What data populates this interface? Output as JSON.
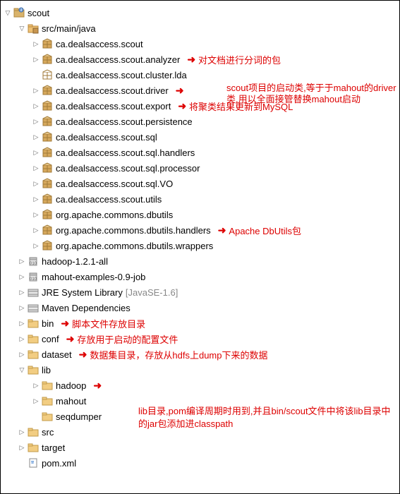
{
  "tree": {
    "root": {
      "label": "scout"
    },
    "srcMainJava": {
      "label": "src/main/java"
    },
    "packages": [
      {
        "label": "ca.dealsaccess.scout",
        "toggle": "closed",
        "icon": "package"
      },
      {
        "label": "ca.dealsaccess.scout.analyzer",
        "toggle": "closed",
        "icon": "package",
        "note": "对文档进行分词的包"
      },
      {
        "label": "ca.dealsaccess.scout.cluster.lda",
        "toggle": "none",
        "icon": "package-empty"
      },
      {
        "label": "ca.dealsaccess.scout.driver",
        "toggle": "closed",
        "icon": "package",
        "arrow": true
      },
      {
        "label": "ca.dealsaccess.scout.export",
        "toggle": "closed",
        "icon": "package",
        "note": "将聚类结果更新到MySQL"
      },
      {
        "label": "ca.dealsaccess.scout.persistence",
        "toggle": "closed",
        "icon": "package"
      },
      {
        "label": "ca.dealsaccess.scout.sql",
        "toggle": "closed",
        "icon": "package"
      },
      {
        "label": "ca.dealsaccess.scout.sql.handlers",
        "toggle": "closed",
        "icon": "package"
      },
      {
        "label": "ca.dealsaccess.scout.sql.processor",
        "toggle": "closed",
        "icon": "package"
      },
      {
        "label": "ca.dealsaccess.scout.sql.VO",
        "toggle": "closed",
        "icon": "package"
      },
      {
        "label": "ca.dealsaccess.scout.utils",
        "toggle": "closed",
        "icon": "package"
      },
      {
        "label": "org.apache.commons.dbutils",
        "toggle": "closed",
        "icon": "package"
      },
      {
        "label": "org.apache.commons.dbutils.handlers",
        "toggle": "closed",
        "icon": "package",
        "note": "Apache DbUtils包"
      },
      {
        "label": "org.apache.commons.dbutils.wrappers",
        "toggle": "closed",
        "icon": "package"
      }
    ],
    "driverNote": "scout项目的启动类,等于于mahout的driver类,用以全面接管替换mahout启动",
    "libs": [
      {
        "label": "hadoop-1.2.1-all",
        "toggle": "closed",
        "icon": "jar"
      },
      {
        "label": "mahout-examples-0.9-job",
        "toggle": "closed",
        "icon": "jar"
      },
      {
        "label": "JRE System Library",
        "suffix": "[JavaSE-1.6]",
        "toggle": "closed",
        "icon": "jre"
      },
      {
        "label": "Maven Dependencies",
        "toggle": "closed",
        "icon": "jre"
      }
    ],
    "folders": [
      {
        "label": "bin",
        "toggle": "closed",
        "icon": "folder",
        "note": "脚本文件存放目录"
      },
      {
        "label": "conf",
        "toggle": "closed",
        "icon": "folder",
        "note": "存放用于启动的配置文件"
      },
      {
        "label": "dataset",
        "toggle": "closed",
        "icon": "folder",
        "note": "数据集目录，存放从hdfs上dump下来的数据"
      },
      {
        "label": "lib",
        "toggle": "open",
        "icon": "folder"
      }
    ],
    "libNote": "lib目录,pom编译周期时用到,并且bin/scout文件中将该lib目录中的jar包添加进classpath",
    "libChildren": [
      {
        "label": "hadoop",
        "toggle": "closed",
        "icon": "folder",
        "arrow": true
      },
      {
        "label": "mahout",
        "toggle": "closed",
        "icon": "folder"
      },
      {
        "label": "seqdumper",
        "toggle": "none",
        "icon": "folder"
      }
    ],
    "bottom": [
      {
        "label": "src",
        "toggle": "closed",
        "icon": "folder"
      },
      {
        "label": "target",
        "toggle": "closed",
        "icon": "folder"
      },
      {
        "label": "pom.xml",
        "toggle": "none",
        "icon": "file"
      }
    ]
  }
}
